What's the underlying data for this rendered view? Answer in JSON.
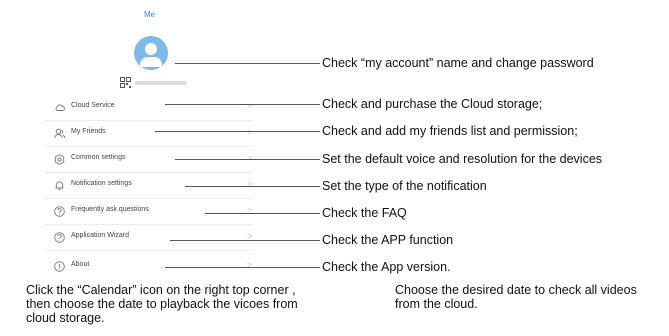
{
  "phone": {
    "title": "Me",
    "menu": [
      {
        "label": "Cloud Service",
        "icon": "cloud-icon"
      },
      {
        "label": "My Friends",
        "icon": "friends-icon"
      },
      {
        "label": "Common settings",
        "icon": "settings-icon"
      },
      {
        "label": "Notification settings",
        "icon": "bell-icon"
      },
      {
        "label": "Frequently ask questions",
        "icon": "question-icon"
      },
      {
        "label": "Application Wizard",
        "icon": "question-icon"
      },
      {
        "label": "About",
        "icon": "info-icon"
      }
    ],
    "chevron": ">"
  },
  "annotations": {
    "account": "Check  “my account” name and change password",
    "cloud": "Check and purchase the Cloud storage;",
    "friends": "Check and add my friends list and permission;",
    "common": "Set the default voice and resolution for the devices",
    "notification": "Set the type of the notification",
    "faq": "Check the FAQ",
    "wizard": "Check the APP function",
    "about": "Check the App version."
  },
  "captions": {
    "left": "Click the  “Calendar”  icon on the right top corner , then choose the date to playback the vicoes from cloud storage.",
    "right": "Choose the desired date to check all videos from the cloud."
  },
  "colors": {
    "title_blue": "#3d8ed0",
    "avatar_blue": "#7fb9e6"
  }
}
